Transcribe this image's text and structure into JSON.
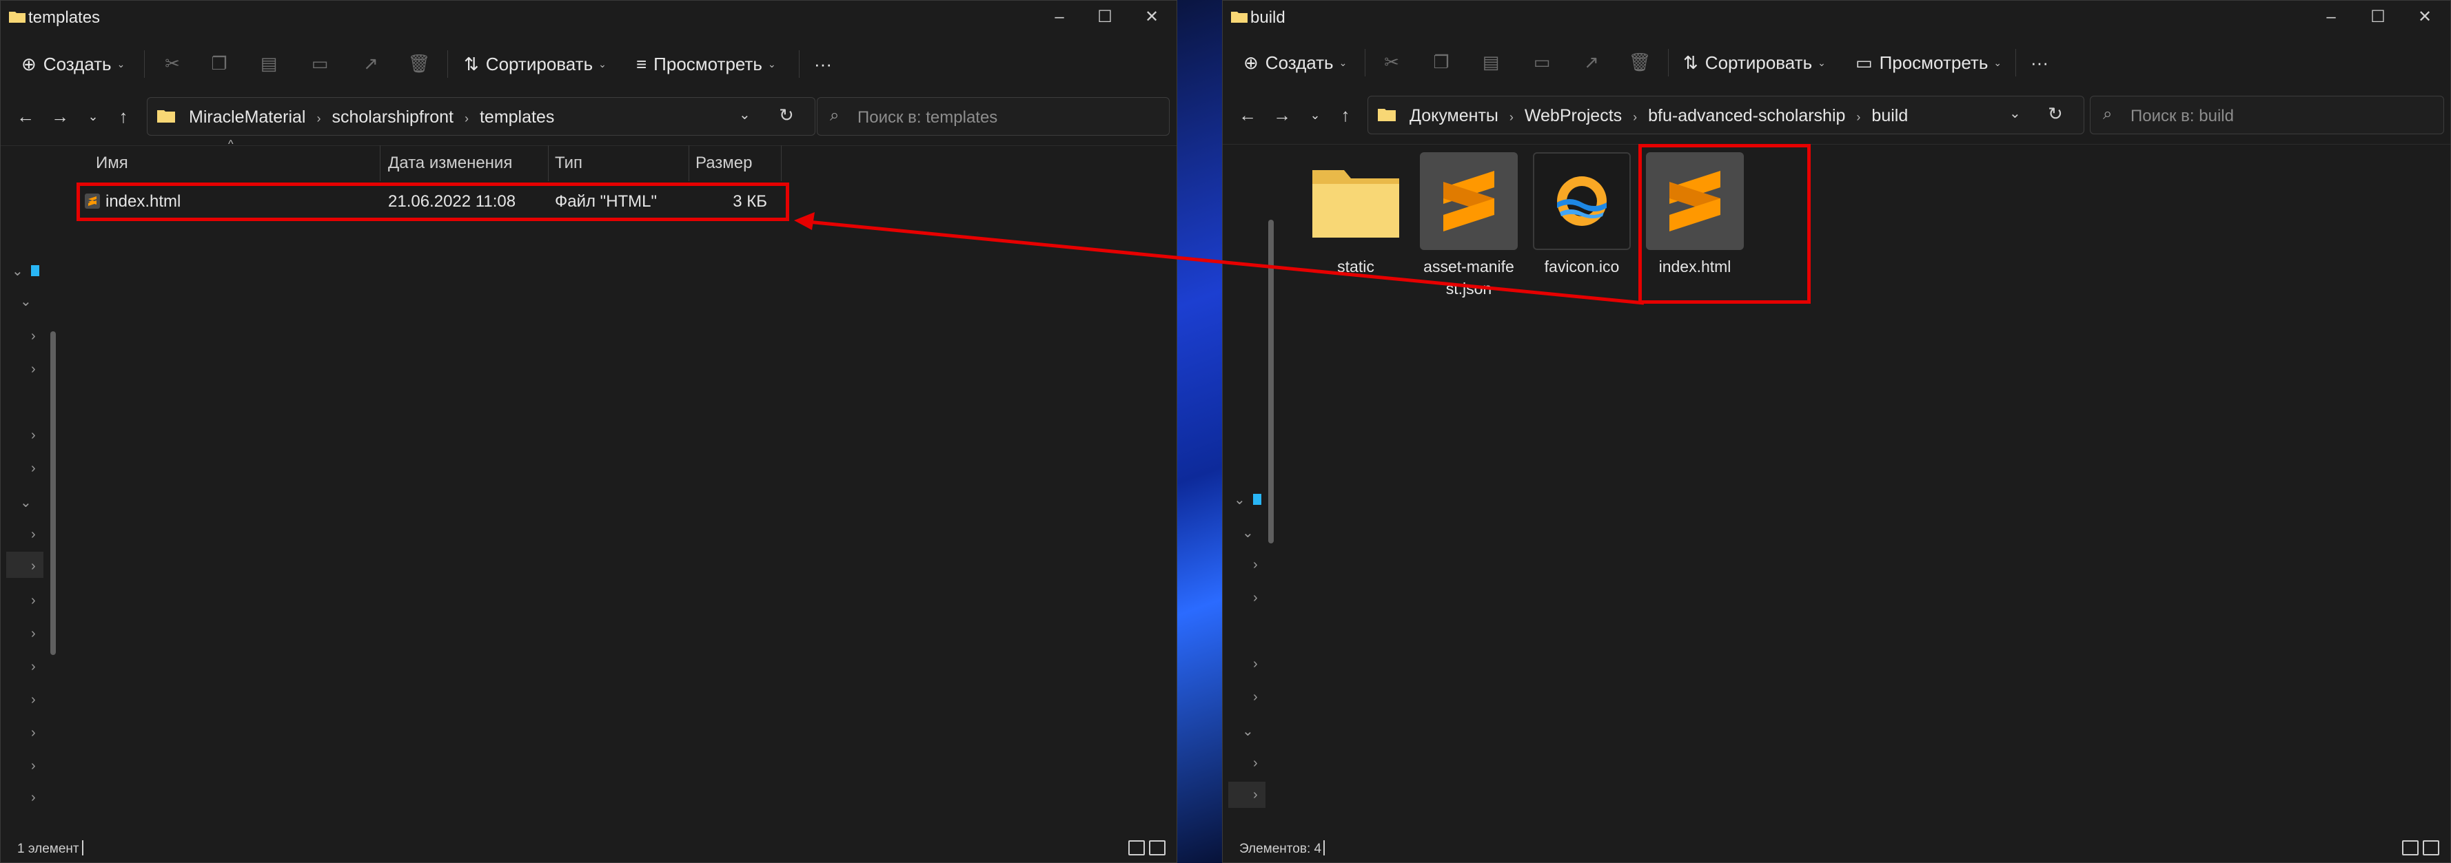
{
  "left_window": {
    "title": "templates",
    "toolbar": {
      "create": "Создать",
      "sort": "Сортировать",
      "view": "Просмотреть",
      "more": "···"
    },
    "breadcrumbs": [
      "MiracleMaterial",
      "scholarshipfront",
      "templates"
    ],
    "search_placeholder": "Поиск в: templates",
    "columns": {
      "name": "Имя",
      "date": "Дата изменения",
      "type": "Тип",
      "size": "Размер"
    },
    "files": [
      {
        "name": "index.html",
        "date": "21.06.2022 11:08",
        "type": "Файл \"HTML\"",
        "size": "3 КБ"
      }
    ],
    "status": "1 элемент"
  },
  "right_window": {
    "title": "build",
    "toolbar": {
      "create": "Создать",
      "sort": "Сортировать",
      "view": "Просмотреть",
      "more": "···"
    },
    "breadcrumbs": [
      "Документы",
      "WebProjects",
      "bfu-advanced-scholarship",
      "build"
    ],
    "search_placeholder": "Поиск в: build",
    "tiles": [
      {
        "label": "static",
        "icon": "folder-icon"
      },
      {
        "label": "asset-manifest.json",
        "icon": "sublime-text-icon"
      },
      {
        "label": "favicon.ico",
        "icon": "favicon-icon"
      },
      {
        "label": "index.html",
        "icon": "sublime-text-icon"
      }
    ],
    "status": "Элементов: 4"
  },
  "colors": {
    "highlight": "#e60000",
    "window_bg": "#1c1c1c",
    "sublime_orange": "#ff9800",
    "folder_yellow": "#f8d775"
  }
}
